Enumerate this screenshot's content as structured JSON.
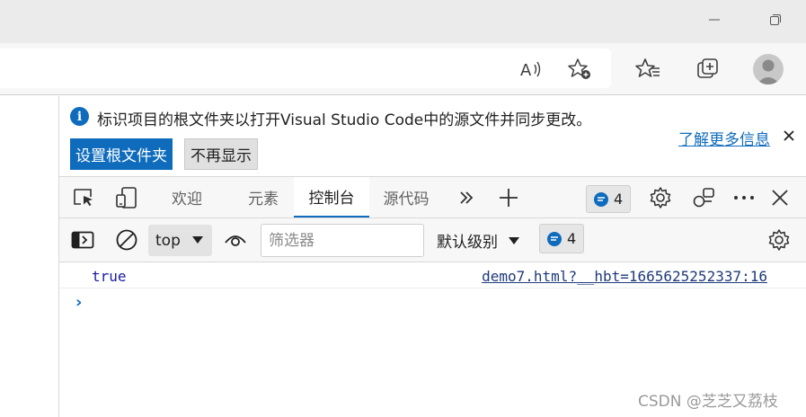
{
  "window": {
    "minimize_icon": "minimize-icon",
    "restore_icon": "restore-icon"
  },
  "toolbar": {
    "read_aloud_icon": "read-aloud-icon",
    "add_favorite_icon": "add-favorite-icon",
    "favorites_icon": "favorites-icon",
    "collections_icon": "collections-icon",
    "profile_icon": "profile-avatar"
  },
  "infobar": {
    "message": "标识项目的根文件夹以打开Visual Studio Code中的源文件并同步更改。",
    "primary_button": "设置根文件夹",
    "secondary_button": "不再显示",
    "learn_more": "了解更多信息"
  },
  "tabs": {
    "items": [
      {
        "label": "欢迎",
        "active": false
      },
      {
        "label": "元素",
        "active": false
      },
      {
        "label": "控制台",
        "active": true
      },
      {
        "label": "源代码",
        "active": false
      }
    ],
    "issues_count": "4"
  },
  "console_toolbar": {
    "context": "top",
    "filter_placeholder": "筛选器",
    "level": "默认级别",
    "issues_count": "4"
  },
  "console": {
    "entries": [
      {
        "value": "true",
        "source": "demo7.html?__hbt=1665625252337:16"
      }
    ],
    "prompt": "›"
  },
  "watermark": "CSDN @芝芝又荔枝",
  "colors": {
    "accent": "#0f6cbd",
    "toolbar_bg": "#f7f7f7",
    "titlebar_bg": "#ebebeb"
  }
}
